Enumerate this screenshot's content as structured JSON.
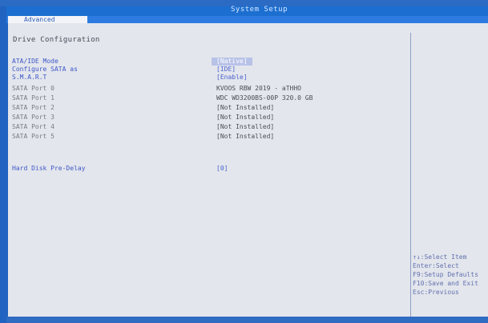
{
  "window": {
    "title": "System Setup"
  },
  "menu": {
    "tabs": [
      {
        "label": "Advanced",
        "selected": true
      }
    ]
  },
  "section": {
    "title": "Drive Configuration"
  },
  "settings": [
    {
      "label": "ATA/IDE Mode",
      "value": "[Native]",
      "state": "selected"
    },
    {
      "label": "Configure SATA as",
      "value": "[IDE]",
      "state": "option"
    },
    {
      "label": "S.M.A.R.T",
      "value": "[Enable]",
      "state": "option"
    },
    {
      "label": "SATA Port 0",
      "value": "KVOOS  RBW 2019  - aTHHO",
      "state": "info"
    },
    {
      "label": "SATA Port 1",
      "value": "WDC WD3200BS-00P   320.0 GB",
      "state": "info"
    },
    {
      "label": "SATA Port 2",
      "value": "[Not Installed]",
      "state": "info"
    },
    {
      "label": "SATA Port 3",
      "value": "[Not Installed]",
      "state": "info"
    },
    {
      "label": "SATA Port 4",
      "value": "[Not Installed]",
      "state": "info"
    },
    {
      "label": "SATA Port 5",
      "value": "[Not Installed]",
      "state": "info"
    },
    {
      "label": "Hard Disk Pre-Delay",
      "value": "[0]",
      "state": "option"
    }
  ],
  "help": {
    "lines": [
      "↑↓:Select Item",
      "Enter:Select",
      "F9:Setup Defaults",
      "F10:Save and Exit",
      "Esc:Previous"
    ]
  },
  "colors": {
    "frame": "#1d5fb8",
    "title_bar": "#1c6fd0",
    "menu_bar": "#2d7be0",
    "panel": "#e3e6ec",
    "option_text": "#3f57c8",
    "info_text": "#7a7c84",
    "selected_bg": "#b8c2e8"
  }
}
